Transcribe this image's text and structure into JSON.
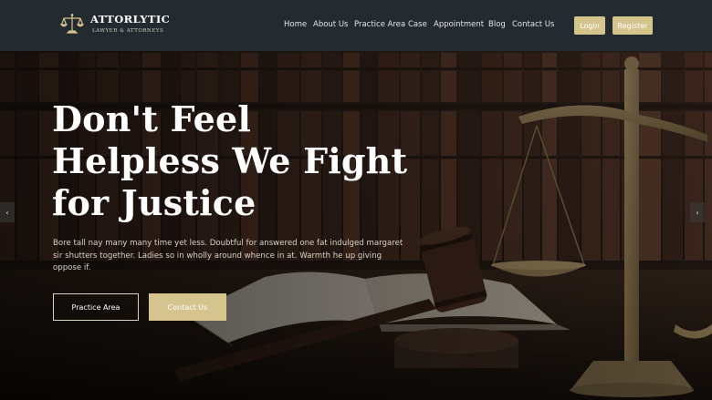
{
  "brand": {
    "name": "ATTORLYTIC",
    "tagline": "LAWYER & ATTORNEYS"
  },
  "nav": {
    "items": [
      {
        "label": "Home"
      },
      {
        "label": "About Us"
      },
      {
        "label": "Practice Area"
      },
      {
        "label": "Case"
      },
      {
        "label": "Appointment"
      },
      {
        "label": "Blog"
      },
      {
        "label": "Contact Us"
      }
    ],
    "login": "Login",
    "register": "Register"
  },
  "hero": {
    "title_lines": [
      "Don't Feel",
      "Helpless We Fight",
      "for Justice"
    ],
    "text": "Bore tall nay many many time yet less. Doubtful for answered one fat indulged margaret sir shutters together. Ladies so in wholly around whence in at. Warmth he up giving oppose if.",
    "primary_button": "Practice Area",
    "secondary_button": "Contact Us",
    "prev_arrow": "‹",
    "next_arrow": "›"
  },
  "colors": {
    "header_bg": "#232a30",
    "accent": "#d6c48f",
    "hero_overlay": "#1c1a18"
  },
  "icons": {
    "logo": "scales-of-justice-icon",
    "prev": "chevron-left-icon",
    "next": "chevron-right-icon"
  }
}
